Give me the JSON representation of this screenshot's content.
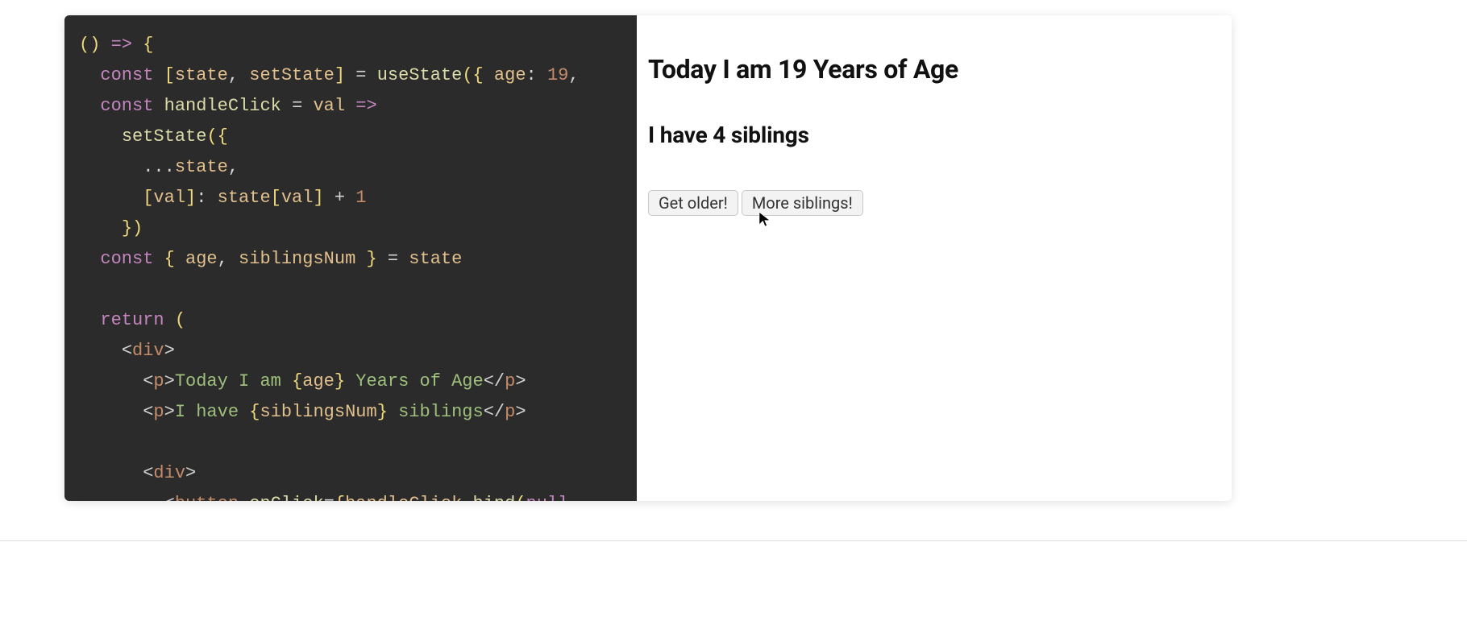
{
  "code": {
    "tokens": [
      [
        {
          "t": "paren",
          "v": "() "
        },
        {
          "t": "kw",
          "v": "=> "
        },
        {
          "t": "paren",
          "v": "{"
        }
      ],
      [
        {
          "t": "plain",
          "v": "  "
        },
        {
          "t": "kw",
          "v": "const"
        },
        {
          "t": "plain",
          "v": " "
        },
        {
          "t": "paren",
          "v": "["
        },
        {
          "t": "id",
          "v": "state"
        },
        {
          "t": "op",
          "v": ", "
        },
        {
          "t": "id",
          "v": "setState"
        },
        {
          "t": "paren",
          "v": "]"
        },
        {
          "t": "plain",
          "v": " "
        },
        {
          "t": "op",
          "v": "="
        },
        {
          "t": "plain",
          "v": " "
        },
        {
          "t": "fn",
          "v": "useState"
        },
        {
          "t": "paren",
          "v": "({"
        },
        {
          "t": "plain",
          "v": " "
        },
        {
          "t": "id",
          "v": "age"
        },
        {
          "t": "op",
          "v": ": "
        },
        {
          "t": "num",
          "v": "19"
        },
        {
          "t": "op",
          "v": ","
        }
      ],
      [
        {
          "t": "plain",
          "v": "  "
        },
        {
          "t": "kw",
          "v": "const"
        },
        {
          "t": "plain",
          "v": " "
        },
        {
          "t": "fn",
          "v": "handleClick"
        },
        {
          "t": "plain",
          "v": " "
        },
        {
          "t": "op",
          "v": "="
        },
        {
          "t": "plain",
          "v": " "
        },
        {
          "t": "id",
          "v": "val"
        },
        {
          "t": "plain",
          "v": " "
        },
        {
          "t": "kw",
          "v": "=>"
        }
      ],
      [
        {
          "t": "plain",
          "v": "    "
        },
        {
          "t": "fn",
          "v": "setState"
        },
        {
          "t": "paren",
          "v": "({"
        }
      ],
      [
        {
          "t": "plain",
          "v": "      "
        },
        {
          "t": "op",
          "v": "..."
        },
        {
          "t": "id",
          "v": "state"
        },
        {
          "t": "op",
          "v": ","
        }
      ],
      [
        {
          "t": "plain",
          "v": "      "
        },
        {
          "t": "paren",
          "v": "["
        },
        {
          "t": "id",
          "v": "val"
        },
        {
          "t": "paren",
          "v": "]"
        },
        {
          "t": "op",
          "v": ": "
        },
        {
          "t": "id",
          "v": "state"
        },
        {
          "t": "paren",
          "v": "["
        },
        {
          "t": "id",
          "v": "val"
        },
        {
          "t": "paren",
          "v": "]"
        },
        {
          "t": "plain",
          "v": " "
        },
        {
          "t": "op",
          "v": "+ "
        },
        {
          "t": "num",
          "v": "1"
        }
      ],
      [
        {
          "t": "plain",
          "v": "    "
        },
        {
          "t": "paren",
          "v": "})"
        }
      ],
      [
        {
          "t": "plain",
          "v": "  "
        },
        {
          "t": "kw",
          "v": "const"
        },
        {
          "t": "plain",
          "v": " "
        },
        {
          "t": "paren",
          "v": "{"
        },
        {
          "t": "plain",
          "v": " "
        },
        {
          "t": "id",
          "v": "age"
        },
        {
          "t": "op",
          "v": ", "
        },
        {
          "t": "id",
          "v": "siblingsNum"
        },
        {
          "t": "plain",
          "v": " "
        },
        {
          "t": "paren",
          "v": "}"
        },
        {
          "t": "plain",
          "v": " "
        },
        {
          "t": "op",
          "v": "="
        },
        {
          "t": "plain",
          "v": " "
        },
        {
          "t": "id",
          "v": "state"
        }
      ],
      [
        {
          "t": "plain",
          "v": ""
        }
      ],
      [
        {
          "t": "plain",
          "v": "  "
        },
        {
          "t": "kw",
          "v": "return"
        },
        {
          "t": "plain",
          "v": " "
        },
        {
          "t": "paren",
          "v": "("
        }
      ],
      [
        {
          "t": "plain",
          "v": "    "
        },
        {
          "t": "op",
          "v": "<"
        },
        {
          "t": "jsx",
          "v": "div"
        },
        {
          "t": "op",
          "v": ">"
        }
      ],
      [
        {
          "t": "plain",
          "v": "      "
        },
        {
          "t": "op",
          "v": "<"
        },
        {
          "t": "jsx",
          "v": "p"
        },
        {
          "t": "op",
          "v": ">"
        },
        {
          "t": "jsxtxt",
          "v": "Today I am "
        },
        {
          "t": "paren",
          "v": "{"
        },
        {
          "t": "id",
          "v": "age"
        },
        {
          "t": "paren",
          "v": "}"
        },
        {
          "t": "jsxtxt",
          "v": " Years of Age"
        },
        {
          "t": "op",
          "v": "</"
        },
        {
          "t": "jsx",
          "v": "p"
        },
        {
          "t": "op",
          "v": ">"
        }
      ],
      [
        {
          "t": "plain",
          "v": "      "
        },
        {
          "t": "op",
          "v": "<"
        },
        {
          "t": "jsx",
          "v": "p"
        },
        {
          "t": "op",
          "v": ">"
        },
        {
          "t": "jsxtxt",
          "v": "I have "
        },
        {
          "t": "paren",
          "v": "{"
        },
        {
          "t": "id",
          "v": "siblingsNum"
        },
        {
          "t": "paren",
          "v": "}"
        },
        {
          "t": "jsxtxt",
          "v": " siblings"
        },
        {
          "t": "op",
          "v": "</"
        },
        {
          "t": "jsx",
          "v": "p"
        },
        {
          "t": "op",
          "v": ">"
        }
      ],
      [
        {
          "t": "plain",
          "v": ""
        }
      ],
      [
        {
          "t": "plain",
          "v": "      "
        },
        {
          "t": "op",
          "v": "<"
        },
        {
          "t": "jsx",
          "v": "div"
        },
        {
          "t": "op",
          "v": ">"
        }
      ],
      [
        {
          "t": "plain",
          "v": "        "
        },
        {
          "t": "op",
          "v": "<"
        },
        {
          "t": "jsx",
          "v": "button"
        },
        {
          "t": "plain",
          "v": " "
        },
        {
          "t": "fn",
          "v": "onClick"
        },
        {
          "t": "op",
          "v": "="
        },
        {
          "t": "paren",
          "v": "{"
        },
        {
          "t": "id",
          "v": "handleClick"
        },
        {
          "t": "op",
          "v": "."
        },
        {
          "t": "fn",
          "v": "bind"
        },
        {
          "t": "paren",
          "v": "("
        },
        {
          "t": "kw",
          "v": "null"
        }
      ]
    ]
  },
  "preview": {
    "line1": "Today I am 19 Years of Age",
    "line2": "I have 4 siblings",
    "button1": "Get older!",
    "button2": "More siblings!"
  }
}
